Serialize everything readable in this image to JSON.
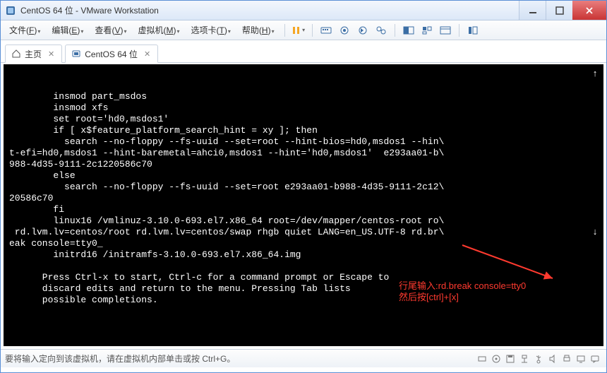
{
  "window": {
    "title": "CentOS 64 位 - VMware Workstation"
  },
  "menus": {
    "file": {
      "label": "文件",
      "key": "F"
    },
    "edit": {
      "label": "编辑",
      "key": "E"
    },
    "view": {
      "label": "查看",
      "key": "V"
    },
    "vm": {
      "label": "虚拟机",
      "key": "M"
    },
    "tabs": {
      "label": "选项卡",
      "key": "T"
    },
    "help": {
      "label": "帮助",
      "key": "H"
    }
  },
  "toolbar": {
    "pause_color": "#f5a623",
    "play_color": "#2e9e4a",
    "icon_color": "#3b6ea5"
  },
  "tabs": {
    "home": {
      "label": "主页"
    },
    "vmtab": {
      "label": "CentOS 64 位"
    }
  },
  "terminal": {
    "lines": [
      "",
      "",
      "        insmod part_msdos",
      "        insmod xfs",
      "        set root='hd0,msdos1'",
      "        if [ x$feature_platform_search_hint = xy ]; then",
      "          search --no-floppy --fs-uuid --set=root --hint-bios=hd0,msdos1 --hin\\",
      "t-efi=hd0,msdos1 --hint-baremetal=ahci0,msdos1 --hint='hd0,msdos1'  e293aa01-b\\",
      "988-4d35-9111-2c1220586c70",
      "        else",
      "          search --no-floppy --fs-uuid --set=root e293aa01-b988-4d35-9111-2c12\\",
      "20586c70",
      "        fi",
      "        linux16 /vmlinuz-3.10.0-693.el7.x86_64 root=/dev/mapper/centos-root ro\\",
      " rd.lvm.lv=centos/root rd.lvm.lv=centos/swap rhgb quiet LANG=en_US.UTF-8 rd.br\\",
      "eak console=tty0_",
      "        initrd16 /initramfs-3.10.0-693.el7.x86_64.img",
      "",
      "      Press Ctrl-x to start, Ctrl-c for a command prompt or Escape to",
      "      discard edits and return to the menu. Pressing Tab lists",
      "      possible completions."
    ],
    "up_indicator": "↑",
    "down_indicator": "↓"
  },
  "annotation": {
    "line1": "行尾输入:rd.break console=tty0",
    "line2": "然后按[ctrl]+[x]"
  },
  "status": {
    "text": "要将输入定向到该虚拟机，请在虚拟机内部单击或按 Ctrl+G。"
  }
}
